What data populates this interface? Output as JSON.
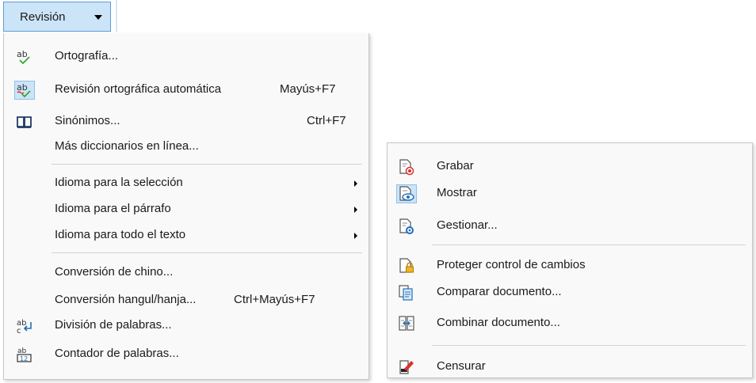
{
  "toolbar": {
    "review_label": "Revisión"
  },
  "review_menu": {
    "spelling": "Ortografía...",
    "auto_spellcheck": "Revisión ortográfica automática",
    "auto_spellcheck_shortcut": "Mayús+F7",
    "thesaurus": "Sinónimos...",
    "thesaurus_shortcut": "Ctrl+F7",
    "more_dictionaries": "Más diccionarios en línea...",
    "lang_selection": "Idioma para la selección",
    "lang_paragraph": "Idioma para el párrafo",
    "lang_all_text": "Idioma para todo el texto",
    "chinese_conversion": "Conversión de chino...",
    "hangul_hanja": "Conversión hangul/hanja...",
    "hangul_hanja_shortcut": "Ctrl+Mayús+F7",
    "hyphenation": "División de palabras...",
    "word_count": "Contador de palabras..."
  },
  "track_changes_menu": {
    "record": "Grabar",
    "show": "Mostrar",
    "manage": "Gestionar...",
    "protect": "Proteger control de cambios",
    "compare": "Comparar documento...",
    "merge": "Combinar documento...",
    "redact": "Censurar"
  },
  "icons": {
    "spelling": "spellcheck-icon",
    "auto_spellcheck": "auto-spellcheck-icon",
    "thesaurus": "book-icon",
    "hyphenation": "hyphenation-icon",
    "word_count": "word-count-icon",
    "record": "record-changes-icon",
    "show": "show-changes-icon",
    "manage": "manage-changes-icon",
    "protect": "protect-changes-icon",
    "compare": "compare-document-icon",
    "merge": "merge-document-icon",
    "redact": "redact-icon"
  },
  "colors": {
    "selected_bg": "#cce4f7",
    "selected_border": "#5b9bd5",
    "accent_green": "#3aa63a",
    "accent_red": "#d9312b",
    "accent_blue": "#1f6fb8"
  }
}
